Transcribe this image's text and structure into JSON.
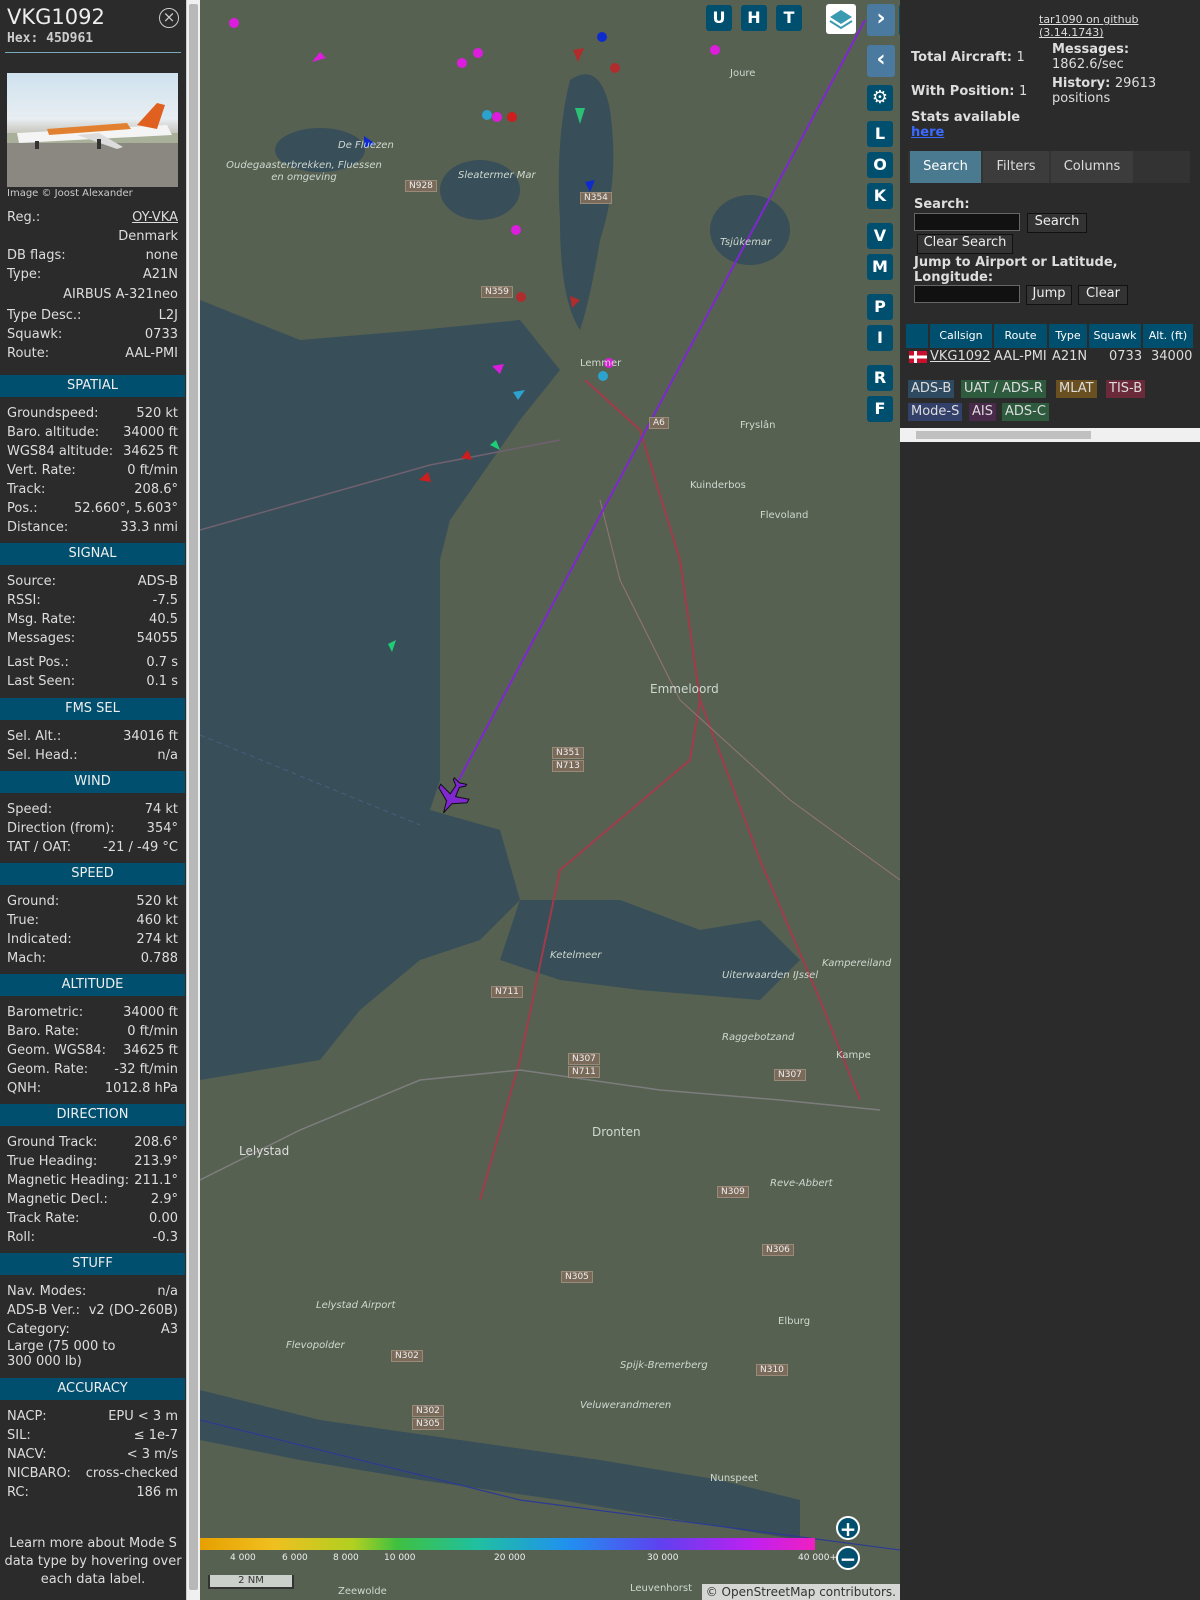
{
  "aircraft": {
    "callsign": "VKG1092",
    "hex_label": "Hex:",
    "hex": "45D961",
    "photo_credit": "Image © Joost Alexander",
    "reg_label": "Reg.:",
    "reg": "OY-VKA",
    "country": "Denmark",
    "dbflags_label": "DB flags:",
    "dbflags": "none",
    "type_label": "Type:",
    "type": "A21N",
    "type_full": "AIRBUS A-321neo",
    "typedesc_label": "Type Desc.:",
    "typedesc": "L2J",
    "squawk_label": "Squawk:",
    "squawk": "0733",
    "route_label": "Route:",
    "route": "AAL-PMI"
  },
  "sections": {
    "spatial": "SPATIAL",
    "signal": "SIGNAL",
    "fms": "FMS SEL",
    "wind": "WIND",
    "speed": "SPEED",
    "altitude": "ALTITUDE",
    "direction": "DIRECTION",
    "stuff": "STUFF",
    "accuracy": "ACCURACY"
  },
  "spatial": [
    {
      "k": "Groundspeed:",
      "v": "520 kt"
    },
    {
      "k": "Baro. altitude:",
      "v": "34000 ft"
    },
    {
      "k": "WGS84 altitude:",
      "v": "34625 ft"
    },
    {
      "k": "Vert. Rate:",
      "v": "0 ft/min"
    },
    {
      "k": "Track:",
      "v": "208.6°"
    },
    {
      "k": "Pos.:",
      "v": "52.660°, 5.603°"
    },
    {
      "k": "Distance:",
      "v": "33.3 nmi"
    }
  ],
  "signal": [
    {
      "k": "Source:",
      "v": "ADS-B"
    },
    {
      "k": "RSSI:",
      "v": "-7.5"
    },
    {
      "k": "Msg. Rate:",
      "v": "40.5"
    },
    {
      "k": "Messages:",
      "v": "54055"
    },
    {
      "k": "Last Pos.:",
      "v": "0.7 s"
    },
    {
      "k": "Last Seen:",
      "v": "0.1 s"
    }
  ],
  "fms": [
    {
      "k": "Sel. Alt.:",
      "v": "34016 ft"
    },
    {
      "k": "Sel. Head.:",
      "v": "n/a"
    }
  ],
  "wind": [
    {
      "k": "Speed:",
      "v": "74 kt"
    },
    {
      "k": "Direction (from):",
      "v": "354°"
    },
    {
      "k": "TAT / OAT:",
      "v": "-21 / -49 °C"
    }
  ],
  "speed": [
    {
      "k": "Ground:",
      "v": "520 kt"
    },
    {
      "k": "True:",
      "v": "460 kt"
    },
    {
      "k": "Indicated:",
      "v": "274 kt"
    },
    {
      "k": "Mach:",
      "v": "0.788"
    }
  ],
  "altitude": [
    {
      "k": "Barometric:",
      "v": "34000 ft"
    },
    {
      "k": "Baro. Rate:",
      "v": "0 ft/min"
    },
    {
      "k": "Geom. WGS84:",
      "v": "34625 ft"
    },
    {
      "k": "Geom. Rate:",
      "v": "-32 ft/min"
    },
    {
      "k": "QNH:",
      "v": "1012.8 hPa"
    }
  ],
  "direction": [
    {
      "k": "Ground Track:",
      "v": "208.6°"
    },
    {
      "k": "True Heading:",
      "v": "213.9°"
    },
    {
      "k": "Magnetic Heading:",
      "v": "211.1°"
    },
    {
      "k": "Magnetic Decl.:",
      "v": "2.9°"
    },
    {
      "k": "Track Rate:",
      "v": "0.00"
    },
    {
      "k": "Roll:",
      "v": "-0.3"
    }
  ],
  "stuff": [
    {
      "k": "Nav. Modes:",
      "v": "n/a"
    },
    {
      "k": "ADS-B Ver.:",
      "v": "v2 (DO-260B)"
    },
    {
      "k": "Category:",
      "v": "A3"
    }
  ],
  "category_desc": "Large (75 000 to 300 000 lb)",
  "accuracy": [
    {
      "k": "NACP:",
      "v": "EPU < 3 m"
    },
    {
      "k": "SIL:",
      "v": "≤ 1e-7"
    },
    {
      "k": "NACV:",
      "v": "< 3 m/s"
    },
    {
      "k": "NICBARO:",
      "v": "cross-checked"
    },
    {
      "k": "RC:",
      "v": "186 m"
    }
  ],
  "learn_more": "Learn more about Mode S data type by hovering over each data label.",
  "map": {
    "buttons_top": [
      "U",
      "H",
      "T"
    ],
    "buttons_side": [
      "L",
      "O",
      "K",
      "V",
      "M",
      "P",
      "I",
      "R",
      "F"
    ],
    "places": [
      "Joure",
      "Oudegaasterbrekken, Fluessen en omgeving",
      "De Fluezen",
      "Sleatermer Mar",
      "Tsjûkemar",
      "Lemmer",
      "Fryslân",
      "Kuinderbos",
      "Flevoland",
      "Emmeloord",
      "Ketelmeer",
      "Kampereiland",
      "Uiterwaarden IJssel",
      "Raggebotzand",
      "Dronten",
      "Lelystad",
      "Reve-Abbert",
      "Elburg",
      "Lelystad Airport",
      "Flevopolder",
      "Spijk-Bremerberg",
      "Veluwerandmeren",
      "Nunspeet",
      "Zeewolde",
      "Leuvenhorst",
      "Kampe"
    ],
    "roads": [
      "N928",
      "N354",
      "N359",
      "A6",
      "N351",
      "N713",
      "N711",
      "N307",
      "N711",
      "N309",
      "N306",
      "N305",
      "N302",
      "N302",
      "N305",
      "N310",
      "N307"
    ],
    "legend_ticks": [
      "4 000",
      "6 000",
      "8 000",
      "10 000",
      "20 000",
      "30 000",
      "40 000+"
    ],
    "scale": "2 NM",
    "attribution": "© OpenStreetMap contributors."
  },
  "stats": {
    "total_aircraft_label": "Total Aircraft:",
    "total_aircraft": "1",
    "with_position_label": "With Position:",
    "with_position": "1",
    "stats_available": "Stats available",
    "here": "here",
    "messages_label": "Messages:",
    "messages": "1862.6/sec",
    "history_label": "History:",
    "history": "29613",
    "history_unit": "positions",
    "github": "tar1090 on github (3.14.1743)"
  },
  "tabs": [
    "Search",
    "Filters",
    "Columns"
  ],
  "search": {
    "label": "Search:",
    "button": "Search",
    "clear": "Clear Search",
    "jump_label": "Jump to Airport or Latitude, Longitude:",
    "jump": "Jump",
    "jump_clear": "Clear"
  },
  "table": {
    "headers": [
      "Callsign",
      "Route",
      "Type",
      "Squawk",
      "Alt. (ft)"
    ],
    "row": {
      "callsign": "VKG1092",
      "route": "AAL-PMI",
      "type": "A21N",
      "squawk": "0733",
      "alt": "34000"
    }
  },
  "sources": [
    "ADS-B",
    "UAT / ADS-R",
    "MLAT",
    "TIS-B",
    "Mode-S",
    "AIS",
    "ADS-C"
  ],
  "colors": {
    "header_bg": "#004f6e",
    "track": "#8a2be2",
    "adsb": "#2e5a7a",
    "uat": "#2e6a4a",
    "mlat": "#7a5a20",
    "tisb": "#7a2a40",
    "modes": "#3a4a8a",
    "ais": "#5a2a5a",
    "adsc": "#2e6a4a"
  }
}
